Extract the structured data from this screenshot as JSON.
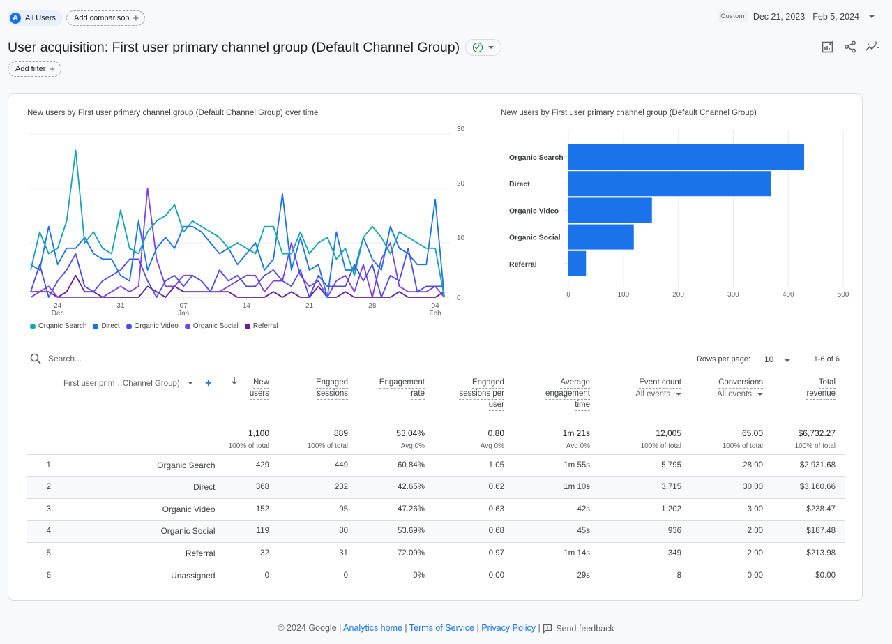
{
  "topbar": {
    "segment_avatar_letter": "A",
    "segment_label": "All Users",
    "add_comparison_label": "Add comparison",
    "date_preset": "Custom",
    "date_range": "Dec 21, 2023 - Feb 5, 2024"
  },
  "header": {
    "title": "User acquisition: First user primary channel group (Default Channel Group)",
    "add_filter_label": "Add filter",
    "icons": [
      "customize-report-icon",
      "share-icon",
      "insights-icon"
    ]
  },
  "chart_data": [
    {
      "type": "line",
      "title": "New users by First user primary channel group (Default Channel Group) over time",
      "x_start": "2023-12-21",
      "x_end": "2024-02-05",
      "x_ticks": [
        {
          "day_index": 3,
          "label": "24",
          "sublabel": "Dec"
        },
        {
          "day_index": 10,
          "label": "31",
          "sublabel": ""
        },
        {
          "day_index": 17,
          "label": "07",
          "sublabel": "Jan"
        },
        {
          "day_index": 24,
          "label": "14",
          "sublabel": ""
        },
        {
          "day_index": 31,
          "label": "21",
          "sublabel": ""
        },
        {
          "day_index": 38,
          "label": "28",
          "sublabel": ""
        },
        {
          "day_index": 45,
          "label": "04",
          "sublabel": "Feb"
        }
      ],
      "y_ticks": [
        0,
        10,
        20,
        30
      ],
      "ylim": [
        0,
        30
      ],
      "y_axis_side": "right",
      "grid": true,
      "legend_position": "bottom-left",
      "series": [
        {
          "name": "Organic Search",
          "color": "#12a4af",
          "values": [
            5,
            12,
            8,
            9,
            14,
            27,
            10,
            12,
            9,
            8,
            16,
            9,
            8,
            12,
            14,
            15,
            17,
            12,
            14,
            13,
            12,
            11,
            9,
            10,
            9,
            8,
            13,
            13,
            8,
            8,
            12,
            8,
            10,
            11,
            7,
            9,
            4,
            11,
            13,
            11,
            8,
            12,
            11,
            10,
            9,
            9,
            0
          ]
        },
        {
          "name": "Direct",
          "color": "#1a73e8",
          "values": [
            6,
            5,
            13,
            6,
            9,
            9,
            11,
            8,
            7,
            7,
            4,
            3,
            14,
            5,
            9,
            11,
            9,
            13,
            13,
            12,
            10,
            8,
            9,
            6,
            8,
            10,
            5,
            7,
            19,
            5,
            11,
            5,
            6,
            0,
            12,
            5,
            5,
            11,
            7,
            5,
            13,
            9,
            8,
            6,
            6,
            18,
            0
          ]
        },
        {
          "name": "Organic Video",
          "color": "#4c4ce8",
          "values": [
            1,
            6,
            0,
            3,
            5,
            8,
            2,
            1,
            3,
            4,
            5,
            7,
            7,
            3,
            0,
            3,
            4,
            2,
            4,
            3,
            1,
            5,
            3,
            4,
            2,
            2,
            4,
            5,
            3,
            2,
            5,
            0,
            4,
            2,
            2,
            2,
            6,
            3,
            6,
            0,
            4,
            3,
            9,
            1,
            2,
            2,
            2
          ]
        },
        {
          "name": "Organic Social",
          "color": "#7b3fe4",
          "values": [
            0,
            1,
            2,
            0,
            0,
            0,
            0,
            0,
            0,
            1,
            2,
            1,
            2,
            20,
            7,
            2,
            2,
            4,
            4,
            3,
            1,
            1,
            2,
            3,
            4,
            4,
            1,
            3,
            3,
            10,
            4,
            2,
            3,
            0,
            3,
            4,
            1,
            6,
            0,
            7,
            10,
            2,
            1,
            1,
            1,
            2,
            0
          ]
        },
        {
          "name": "Referral",
          "color": "#6a1b9a",
          "values": [
            1,
            1,
            1,
            0,
            1,
            4,
            1,
            1,
            0,
            0,
            0,
            0,
            0,
            2,
            1,
            0,
            2,
            1,
            1,
            1,
            1,
            1,
            1,
            0,
            0,
            0,
            0,
            1,
            0,
            1,
            0,
            0,
            2,
            0,
            0,
            1,
            0,
            0,
            0,
            0,
            0,
            1,
            0,
            0,
            0,
            0,
            1
          ]
        }
      ]
    },
    {
      "type": "bar",
      "orientation": "horizontal",
      "title": "New users by First user primary channel group (Default Channel Group)",
      "categories": [
        "Organic Search",
        "Direct",
        "Organic Video",
        "Organic Social",
        "Referral"
      ],
      "values": [
        429,
        368,
        152,
        119,
        32
      ],
      "x_ticks": [
        0,
        100,
        200,
        300,
        400,
        500
      ],
      "xlim": [
        0,
        500
      ],
      "bar_color": "#1a73e8",
      "grid": true
    }
  ],
  "table": {
    "search_placeholder": "Search...",
    "rows_per_page_label": "Rows per page:",
    "rows_per_page_value": "10",
    "page_range": "1-6 of 6",
    "dimension_header": "First user prim…Channel Group)",
    "columns": [
      {
        "key": "new_users",
        "line1": "New",
        "line2": "users",
        "line3": "",
        "sub": "",
        "sorted": true
      },
      {
        "key": "engaged_sessions",
        "line1": "Engaged",
        "line2": "sessions",
        "line3": "",
        "sub": ""
      },
      {
        "key": "engagement_rate",
        "line1": "Engagement",
        "line2": "rate",
        "line3": "",
        "sub": ""
      },
      {
        "key": "engaged_sessions_per_user",
        "line1": "Engaged",
        "line2": "sessions per",
        "line3": "user",
        "sub": ""
      },
      {
        "key": "avg_engagement_time",
        "line1": "Average",
        "line2": "engagement",
        "line3": "time",
        "sub": ""
      },
      {
        "key": "event_count",
        "line1": "Event count",
        "line2": "",
        "line3": "",
        "sub": "All events"
      },
      {
        "key": "conversions",
        "line1": "Conversions",
        "line2": "",
        "line3": "",
        "sub": "All events"
      },
      {
        "key": "total_revenue",
        "line1": "Total",
        "line2": "revenue",
        "line3": "",
        "sub": ""
      }
    ],
    "totals": [
      {
        "value": "1,100",
        "sub": "100% of total"
      },
      {
        "value": "889",
        "sub": "100% of total"
      },
      {
        "value": "53.04%",
        "sub": "Avg 0%"
      },
      {
        "value": "0.80",
        "sub": "Avg 0%"
      },
      {
        "value": "1m 21s",
        "sub": "Avg 0%"
      },
      {
        "value": "12,005",
        "sub": "100% of total"
      },
      {
        "value": "65.00",
        "sub": "100% of total"
      },
      {
        "value": "$6,732.27",
        "sub": "100% of total"
      }
    ],
    "rows": [
      {
        "index": "1",
        "name": "Organic Search",
        "cells": [
          "429",
          "449",
          "60.84%",
          "1.05",
          "1m 55s",
          "5,795",
          "28.00",
          "$2,931.68"
        ]
      },
      {
        "index": "2",
        "name": "Direct",
        "cells": [
          "368",
          "232",
          "42.65%",
          "0.62",
          "1m 10s",
          "3,715",
          "30.00",
          "$3,160.66"
        ]
      },
      {
        "index": "3",
        "name": "Organic Video",
        "cells": [
          "152",
          "95",
          "47.26%",
          "0.63",
          "42s",
          "1,202",
          "3.00",
          "$238.47"
        ]
      },
      {
        "index": "4",
        "name": "Organic Social",
        "cells": [
          "119",
          "80",
          "53.69%",
          "0.68",
          "45s",
          "936",
          "2.00",
          "$187.48"
        ]
      },
      {
        "index": "5",
        "name": "Referral",
        "cells": [
          "32",
          "31",
          "72.09%",
          "0.97",
          "1m 14s",
          "349",
          "2.00",
          "$213.98"
        ]
      },
      {
        "index": "6",
        "name": "Unassigned",
        "cells": [
          "0",
          "0",
          "0%",
          "0.00",
          "29s",
          "8",
          "0.00",
          "$0.00"
        ]
      }
    ]
  },
  "footer": {
    "copyright": "© 2024 Google",
    "links": [
      "Analytics home",
      "Terms of Service",
      "Privacy Policy"
    ],
    "feedback_label": "Send feedback"
  }
}
